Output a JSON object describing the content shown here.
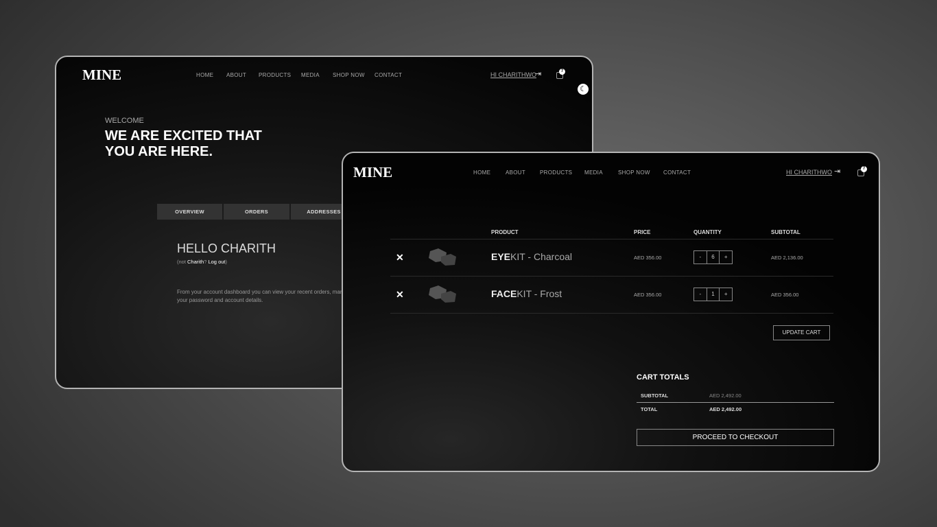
{
  "brand": {
    "logo": "MINE"
  },
  "nav": [
    "HOME",
    "ABOUT",
    "PRODUCTS",
    "MEDIA",
    "SHOP NOW",
    "CONTACT"
  ],
  "user": {
    "greeting": "HI CHARITHWO",
    "cart_count": "7"
  },
  "account": {
    "welcome": "WELCOME",
    "headline_1": "WE ARE EXCITED THAT",
    "headline_2": "YOU ARE HERE.",
    "tabs": [
      "OVERVIEW",
      "ORDERS",
      "ADDRESSES"
    ],
    "hello": "HELLO CHARITH",
    "not_prefix": "(not ",
    "not_name": "Charith",
    "not_q": "? ",
    "logout": "Log out",
    "not_suffix": ")",
    "desc_1": "From your account dashboard you can view your recent orders, mana",
    "desc_2": "your password and account details."
  },
  "cart": {
    "headers": {
      "product": "PRODUCT",
      "price": "PRICE",
      "quantity": "QUANTITY",
      "subtotal": "SUBTOTAL"
    },
    "items": [
      {
        "remove": "✕",
        "name_bold": "EYE",
        "name_rest": "KIT - Charcoal",
        "price": "AED  356.00",
        "minus": "-",
        "qty": "6",
        "plus": "+",
        "subtotal": "AED  2,136.00"
      },
      {
        "remove": "✕",
        "name_bold": "FACE",
        "name_rest": "KIT - Frost",
        "price": "AED  356.00",
        "minus": "-",
        "qty": "1",
        "plus": "+",
        "subtotal": "AED  356.00"
      }
    ],
    "update_label": "UPDATE CART",
    "totals_title": "CART TOTALS",
    "subtotal_label": "SUBTOTAL",
    "subtotal_value": "AED  2,492.00",
    "total_label": "TOTAL",
    "total_value": "AED  2,492.00",
    "checkout_label": "PROCEED TO CHECKOUT"
  },
  "colors": {
    "background": "#555555",
    "window": "#0a0a0a",
    "text": "#ffffff",
    "muted": "#aaaaaa"
  }
}
